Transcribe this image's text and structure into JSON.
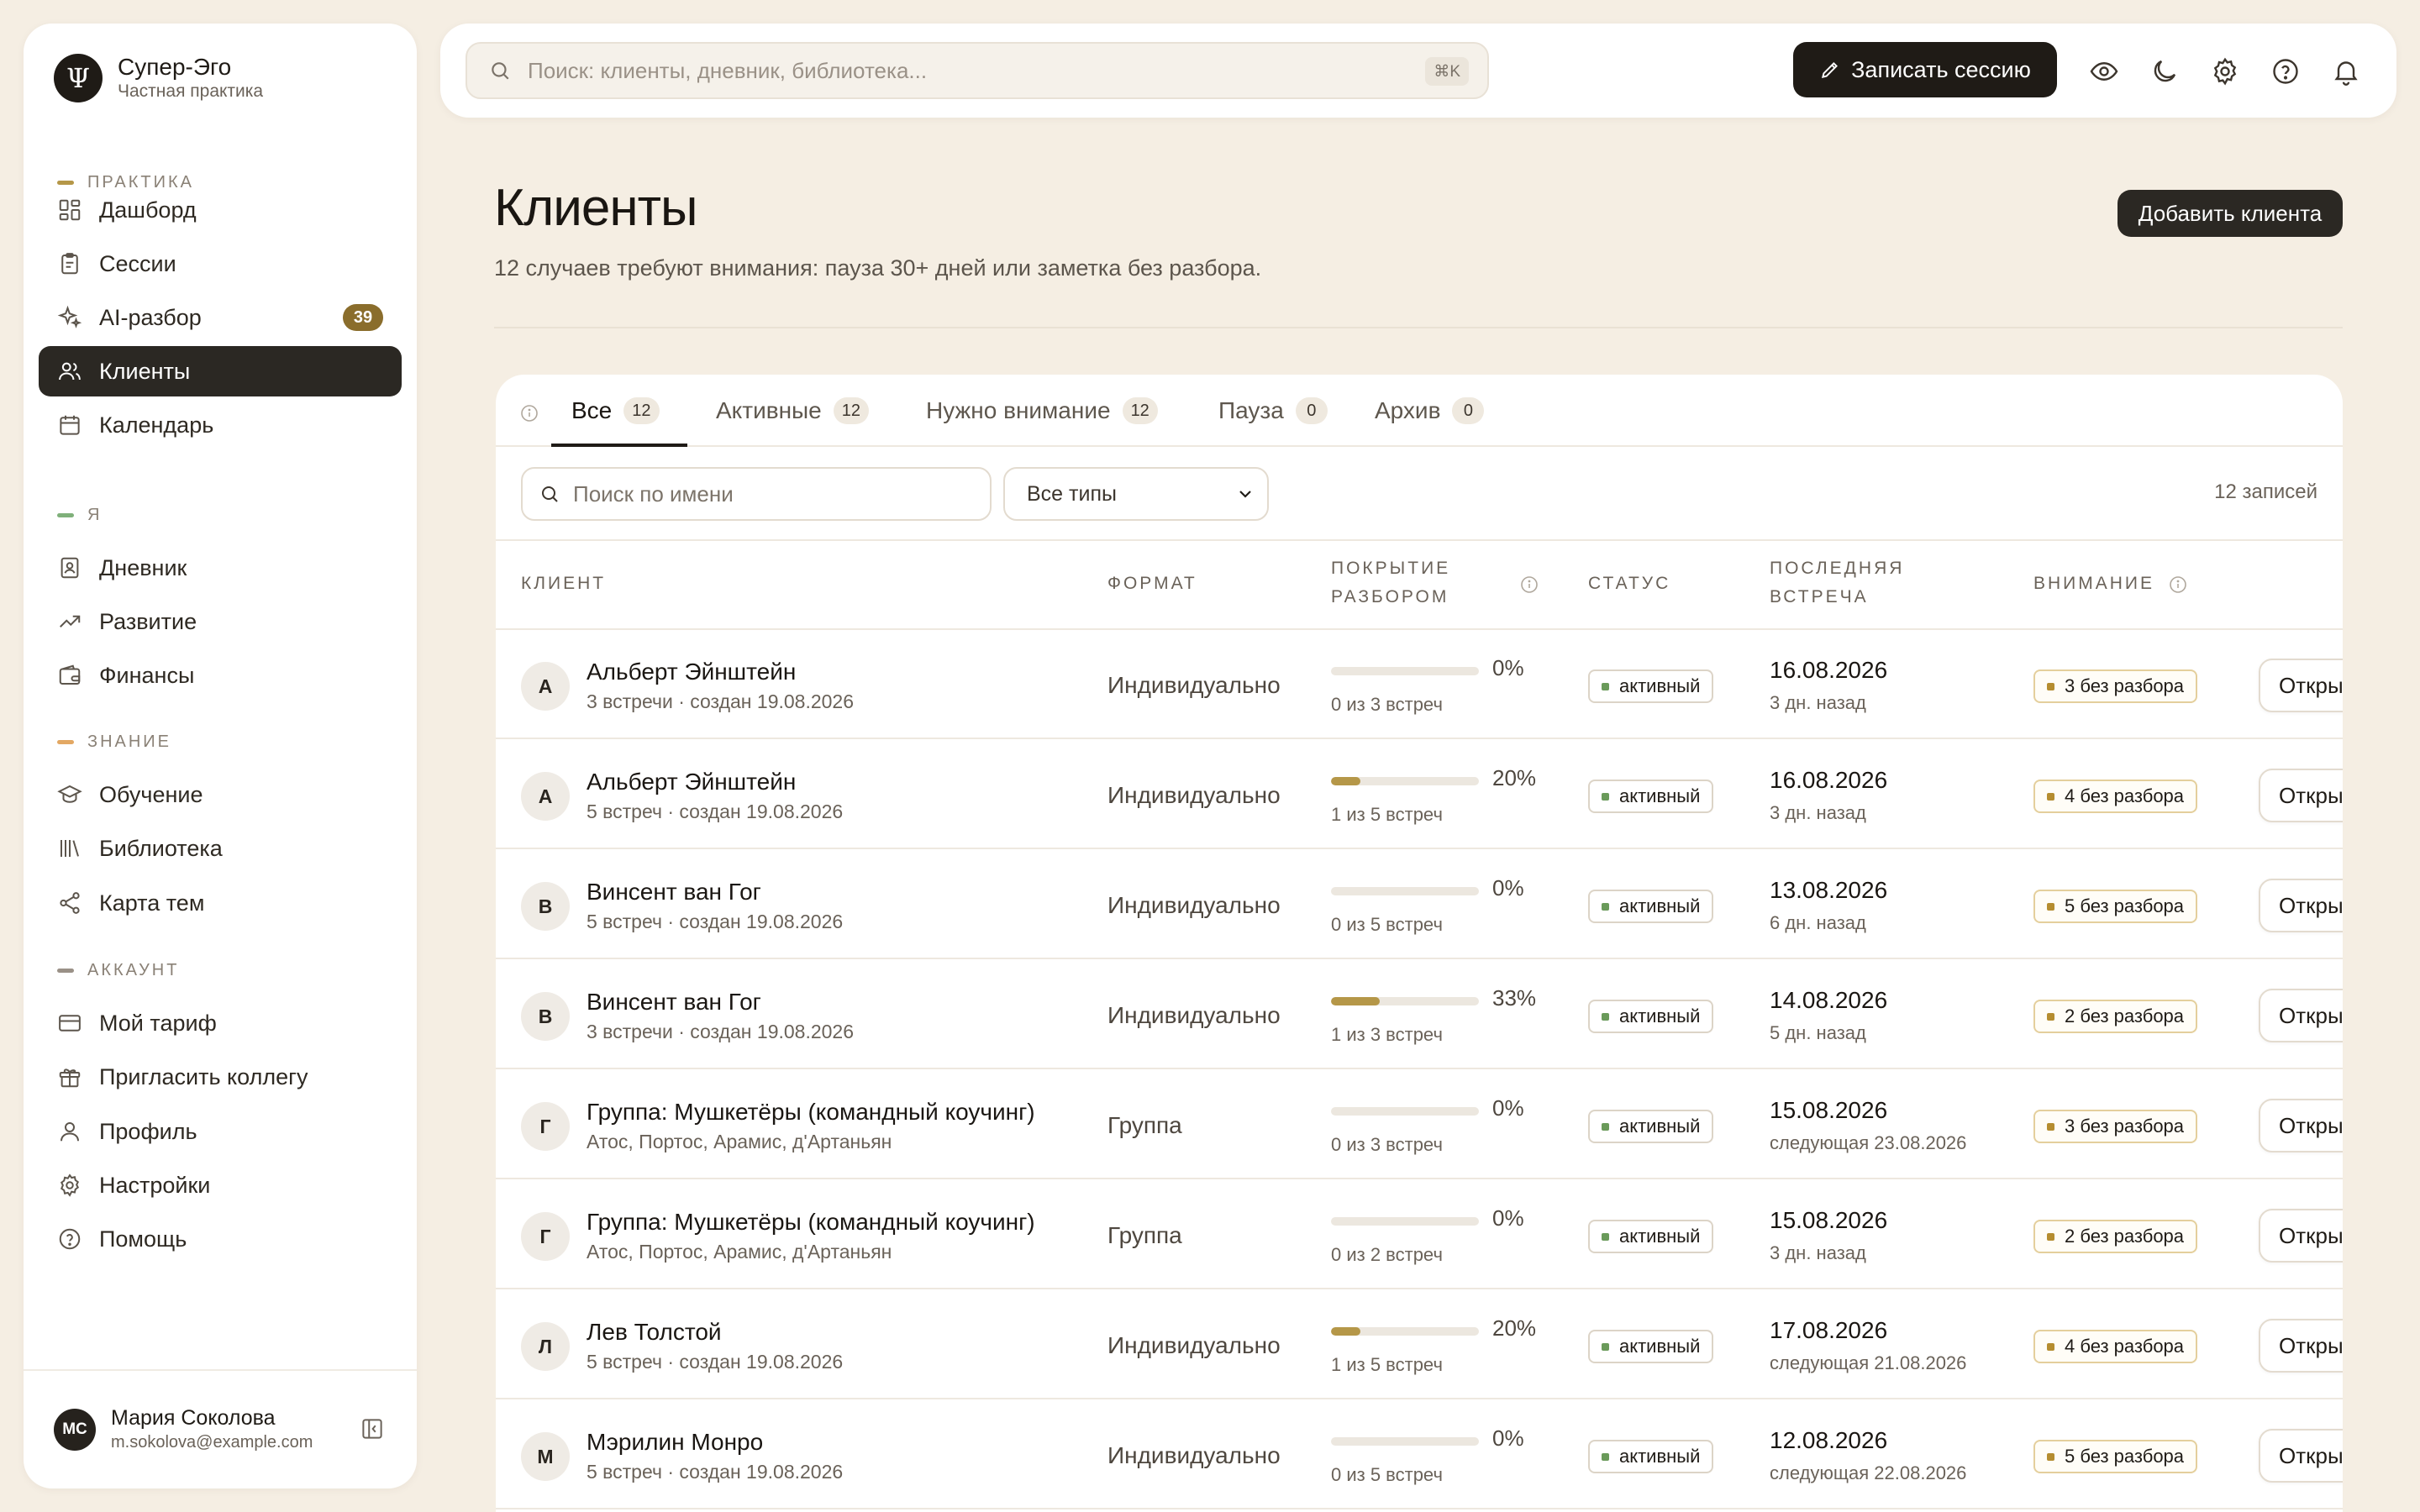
{
  "brand": {
    "logo_glyph": "Ψ",
    "title": "Супер-Эго",
    "subtitle": "Частная практика"
  },
  "sidebar": {
    "sections": [
      {
        "label": "Практика",
        "color": "#b59748"
      },
      {
        "label": "Я",
        "color": "#7fb07a"
      },
      {
        "label": "Знание",
        "color": "#e3a863"
      },
      {
        "label": "Аккаунт",
        "color": "#9a9187"
      }
    ],
    "items": [
      {
        "label": "Дашборд",
        "icon": "dashboard-icon"
      },
      {
        "label": "Сессии",
        "icon": "clipboard-icon"
      },
      {
        "label": "AI-разбор",
        "icon": "sparkles-icon",
        "badge": "39"
      },
      {
        "label": "Клиенты",
        "icon": "users-icon",
        "active": true
      },
      {
        "label": "Календарь",
        "icon": "calendar-icon"
      },
      {
        "label": "Дневник",
        "icon": "journal-icon"
      },
      {
        "label": "Развитие",
        "icon": "trending-up-icon"
      },
      {
        "label": "Финансы",
        "icon": "wallet-icon"
      },
      {
        "label": "Обучение",
        "icon": "graduation-cap-icon"
      },
      {
        "label": "Библиотека",
        "icon": "library-icon"
      },
      {
        "label": "Карта тем",
        "icon": "share-graph-icon"
      },
      {
        "label": "Мой тариф",
        "icon": "credit-card-icon"
      },
      {
        "label": "Пригласить коллегу",
        "icon": "gift-icon"
      },
      {
        "label": "Профиль",
        "icon": "user-icon"
      },
      {
        "label": "Настройки",
        "icon": "gear-icon"
      },
      {
        "label": "Помощь",
        "icon": "help-icon"
      }
    ],
    "user": {
      "initials": "МС",
      "name": "Мария Соколова",
      "email": "m.sokolova@example.com"
    }
  },
  "topbar": {
    "search_placeholder": "Поиск: клиенты, дневник, библиотека...",
    "shortcut": "⌘K",
    "record_label": "Записать сессию"
  },
  "page": {
    "title": "Клиенты",
    "subtitle": "12 случаев требуют внимания: пауза 30+ дней или заметка без разбора.",
    "add_label": "Добавить клиента"
  },
  "tabs": [
    {
      "label": "Все",
      "count": "12",
      "active": true
    },
    {
      "label": "Активные",
      "count": "12"
    },
    {
      "label": "Нужно внимание",
      "count": "12"
    },
    {
      "label": "Пауза",
      "count": "0"
    },
    {
      "label": "Архив",
      "count": "0"
    }
  ],
  "filters": {
    "name_placeholder": "Поиск по имени",
    "type_value": "Все типы",
    "records": "12 записей"
  },
  "columns": {
    "client": "Клиент",
    "format": "Формат",
    "coverage_1": "Покрытие",
    "coverage_2": "разбором",
    "status": "Статус",
    "last_1": "Последняя",
    "last_2": "встреча",
    "attention": "Внимание"
  },
  "rows": [
    {
      "initial": "А",
      "name": "Альберт Эйнштейн",
      "meta": "3 встречи · создан 19.08.2026",
      "format": "Индивидуально",
      "coverage": 0,
      "coverage_pct": "0%",
      "coverage_text": "0 из 3 встреч",
      "status": "активный",
      "date": "16.08.2026",
      "ago": "3 дн. назад",
      "attention": "3 без разбора",
      "open": "Открыть"
    },
    {
      "initial": "А",
      "name": "Альберт Эйнштейн",
      "meta": "5 встреч · создан 19.08.2026",
      "format": "Индивидуально",
      "coverage": 20,
      "coverage_pct": "20%",
      "coverage_text": "1 из 5 встреч",
      "status": "активный",
      "date": "16.08.2026",
      "ago": "3 дн. назад",
      "attention": "4 без разбора",
      "open": "Открыть"
    },
    {
      "initial": "В",
      "name": "Винсент ван Гог",
      "meta": "5 встреч · создан 19.08.2026",
      "format": "Индивидуально",
      "coverage": 0,
      "coverage_pct": "0%",
      "coverage_text": "0 из 5 встреч",
      "status": "активный",
      "date": "13.08.2026",
      "ago": "6 дн. назад",
      "attention": "5 без разбора",
      "open": "Открыть"
    },
    {
      "initial": "В",
      "name": "Винсент ван Гог",
      "meta": "3 встречи · создан 19.08.2026",
      "format": "Индивидуально",
      "coverage": 33,
      "coverage_pct": "33%",
      "coverage_text": "1 из 3 встреч",
      "status": "активный",
      "date": "14.08.2026",
      "ago": "5 дн. назад",
      "attention": "2 без разбора",
      "open": "Открыть"
    },
    {
      "initial": "Г",
      "name": "Группа: Мушкетёры (командный коучинг)",
      "meta": "Атос, Портос, Арамис, д'Артаньян",
      "format": "Группа",
      "coverage": 0,
      "coverage_pct": "0%",
      "coverage_text": "0 из 3 встреч",
      "status": "активный",
      "date": "15.08.2026",
      "ago": "следующая 23.08.2026",
      "attention": "3 без разбора",
      "open": "Открыть"
    },
    {
      "initial": "Г",
      "name": "Группа: Мушкетёры (командный коучинг)",
      "meta": "Атос, Портос, Арамис, д'Артаньян",
      "format": "Группа",
      "coverage": 0,
      "coverage_pct": "0%",
      "coverage_text": "0 из 2 встреч",
      "status": "активный",
      "date": "15.08.2026",
      "ago": "3 дн. назад",
      "attention": "2 без разбора",
      "open": "Открыть"
    },
    {
      "initial": "Л",
      "name": "Лев Толстой",
      "meta": "5 встреч · создан 19.08.2026",
      "format": "Индивидуально",
      "coverage": 20,
      "coverage_pct": "20%",
      "coverage_text": "1 из 5 встреч",
      "status": "активный",
      "date": "17.08.2026",
      "ago": "следующая 21.08.2026",
      "attention": "4 без разбора",
      "open": "Открыть"
    },
    {
      "initial": "М",
      "name": "Мэрилин Монро",
      "meta": "5 встреч · создан 19.08.2026",
      "format": "Индивидуально",
      "coverage": 0,
      "coverage_pct": "0%",
      "coverage_text": "0 из 5 встреч",
      "status": "активный",
      "date": "12.08.2026",
      "ago": "следующая 22.08.2026",
      "attention": "5 без разбора",
      "open": "Открыть"
    }
  ]
}
